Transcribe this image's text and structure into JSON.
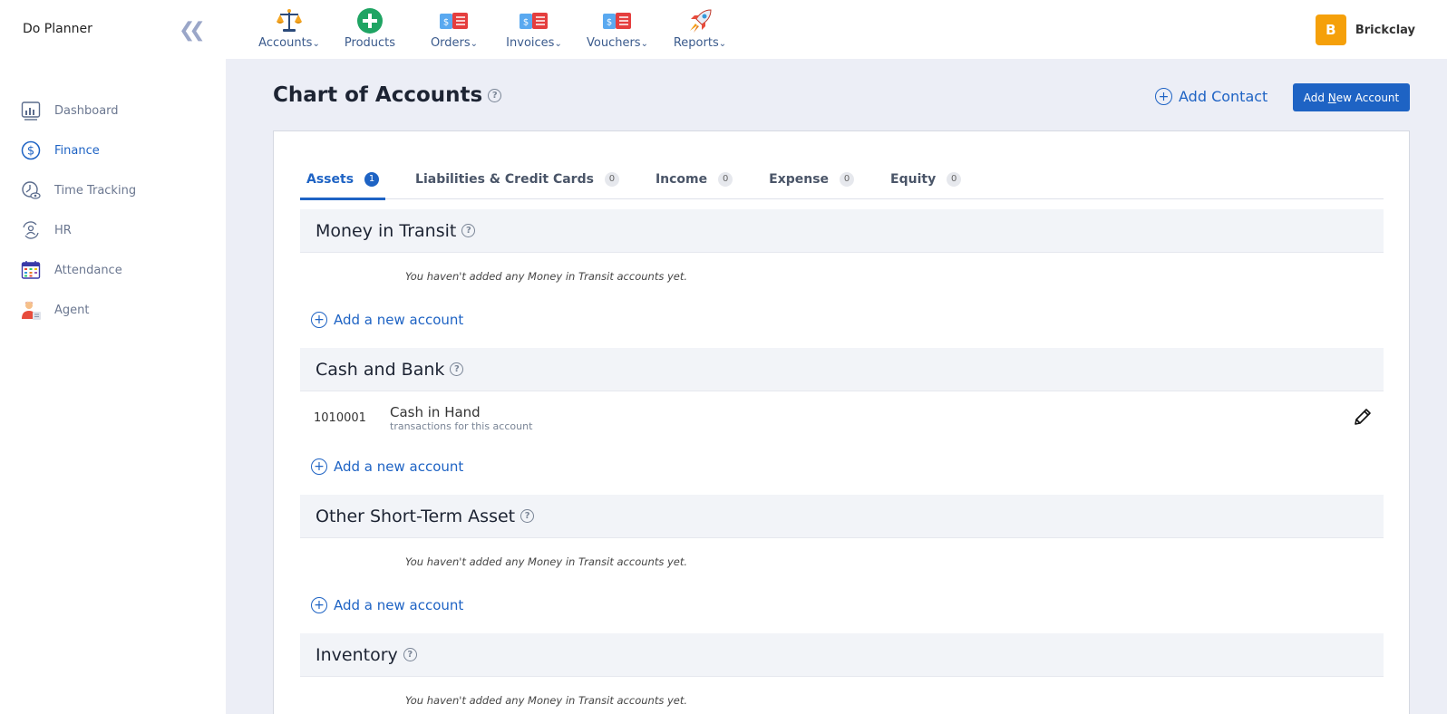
{
  "app": {
    "title": "Do Planner"
  },
  "sidebar": {
    "items": [
      {
        "label": "Dashboard",
        "icon": "dashboard-chart-icon"
      },
      {
        "label": "Finance",
        "icon": "dollar-circle-icon",
        "active": true
      },
      {
        "label": "Time Tracking",
        "icon": "time-tracking-icon"
      },
      {
        "label": "HR",
        "icon": "hr-people-icon"
      },
      {
        "label": "Attendance",
        "icon": "calendar-icon"
      },
      {
        "label": "Agent",
        "icon": "agent-person-icon"
      }
    ]
  },
  "topnav": {
    "items": [
      {
        "label": "Accounts",
        "icon": "scales-icon",
        "dropdown": true
      },
      {
        "label": "Products",
        "icon": "plus-circle-icon",
        "dropdown": false
      },
      {
        "label": "Orders",
        "icon": "receipt-icon",
        "dropdown": true
      },
      {
        "label": "Invoices",
        "icon": "receipt-icon",
        "dropdown": true
      },
      {
        "label": "Vouchers",
        "icon": "receipt-icon",
        "dropdown": true
      },
      {
        "label": "Reports",
        "icon": "rocket-icon",
        "dropdown": true
      }
    ]
  },
  "user": {
    "initial": "B",
    "name": "Brickclay"
  },
  "header": {
    "title": "Chart of Accounts",
    "add_contact": "Add Contact",
    "add_account_prefix": "Add ",
    "add_account_underlined": "N",
    "add_account_suffix": "ew Account"
  },
  "tabs": [
    {
      "label": "Assets",
      "count": "1",
      "active": true
    },
    {
      "label": "Liabilities & Credit Cards",
      "count": "0"
    },
    {
      "label": "Income",
      "count": "0"
    },
    {
      "label": "Expense",
      "count": "0"
    },
    {
      "label": "Equity",
      "count": "0"
    }
  ],
  "sections": [
    {
      "title": "Money in Transit",
      "empty_text": "You haven't added any Money in Transit accounts yet.",
      "add_label": "Add a new account"
    },
    {
      "title": "Cash and Bank",
      "add_label": "Add a new account",
      "accounts": [
        {
          "code": "1010001",
          "name": "Cash in Hand",
          "sub": "transactions for this account"
        }
      ]
    },
    {
      "title": "Other Short-Term Asset",
      "empty_text": "You haven't added any Money in Transit accounts yet.",
      "add_label": "Add a new account"
    },
    {
      "title": "Inventory",
      "empty_text": "You haven't added any Money in Transit accounts yet."
    }
  ],
  "colors": {
    "primary": "#1e63c4",
    "avatar": "#f5a00a",
    "background": "#eceef6"
  }
}
